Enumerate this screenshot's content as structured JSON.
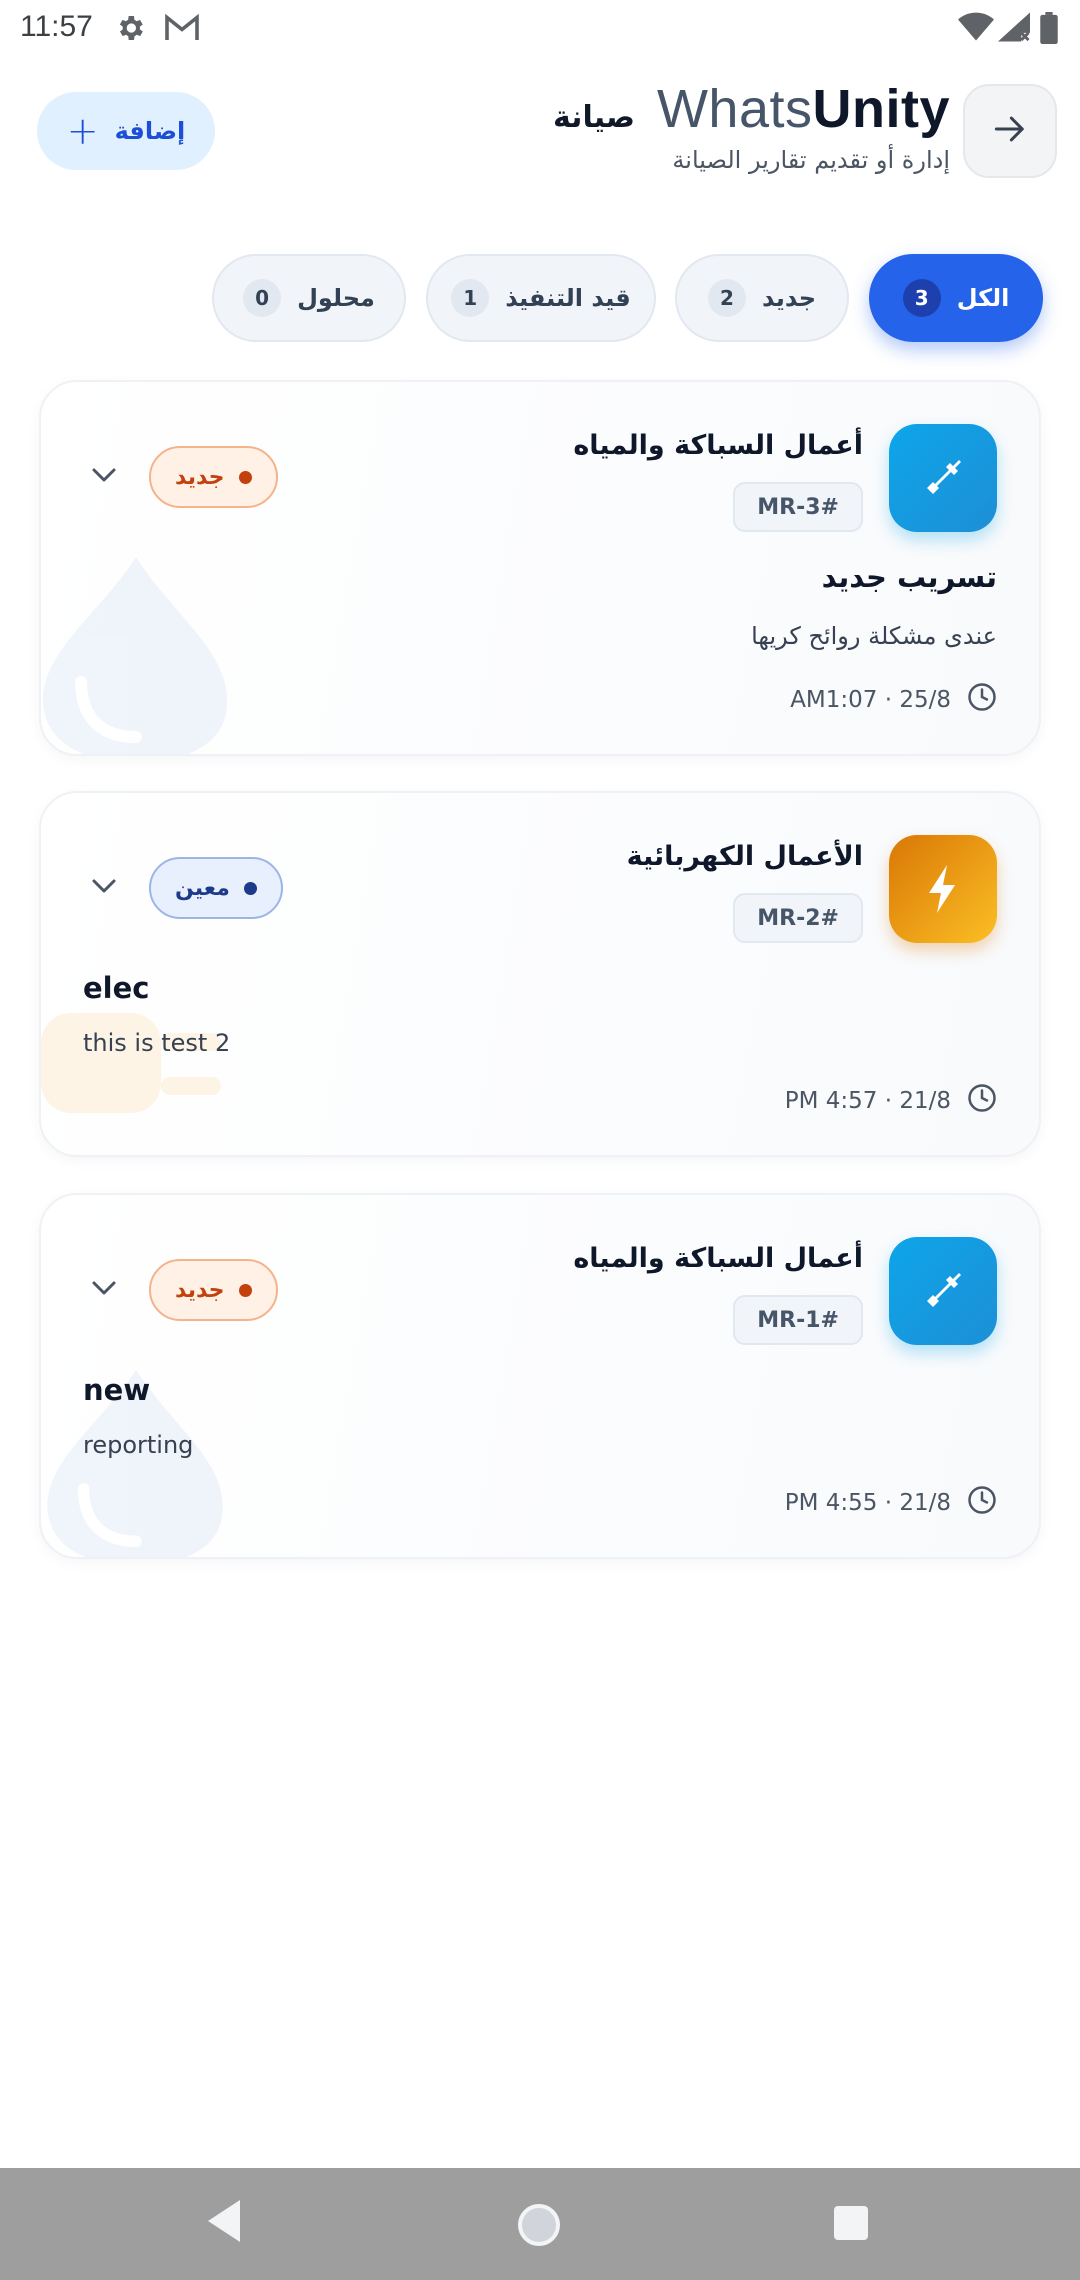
{
  "status_bar": {
    "time": "11:57",
    "icons": [
      "settings-gear-icon",
      "gmail-icon",
      "wifi-icon",
      "signal-icon",
      "battery-icon"
    ]
  },
  "header": {
    "back_icon": "arrow-right-icon",
    "brand_whats": "Whats",
    "brand_unity": "Unity",
    "brand_ar": "صيانة",
    "subtitle": "إدارة أو تقديم تقارير الصيانة",
    "add_label": "إضافة",
    "add_symbol": "+"
  },
  "tabs": [
    {
      "label": "الكل",
      "count": "3",
      "active": true
    },
    {
      "label": "جديد",
      "count": "2",
      "active": false
    },
    {
      "label": "قيد التنفيذ",
      "count": "1",
      "active": false
    },
    {
      "label": "محلول",
      "count": "0",
      "active": false
    }
  ],
  "cards": [
    {
      "category": "أعمال السباكة والمياه",
      "ref": "MR-3#",
      "status": "جديد",
      "title": "تسريب جديد",
      "desc": "عندى مشكلة روائح كريها",
      "time": "AM1:07 · 25/8",
      "icon": "plumbing-wrench-icon"
    },
    {
      "category": "الأعمال الكهربائية",
      "ref": "MR-2#",
      "status": "معين",
      "title": "elec",
      "desc": "this is test 2",
      "time": "PM 4:57 · 21/8",
      "icon": "lightning-bolt-icon"
    },
    {
      "category": "أعمال السباكة والمياه",
      "ref": "MR-1#",
      "status": "جديد",
      "title": "new",
      "desc": "reporting",
      "time": "PM 4:55 · 21/8",
      "icon": "plumbing-wrench-icon"
    }
  ],
  "colors": {
    "primary": "#2563eb",
    "plumbing": "#0ea5e9",
    "electric": "#f59e0b",
    "status_new": "#c2410c",
    "status_assigned": "#1e3a8a"
  }
}
